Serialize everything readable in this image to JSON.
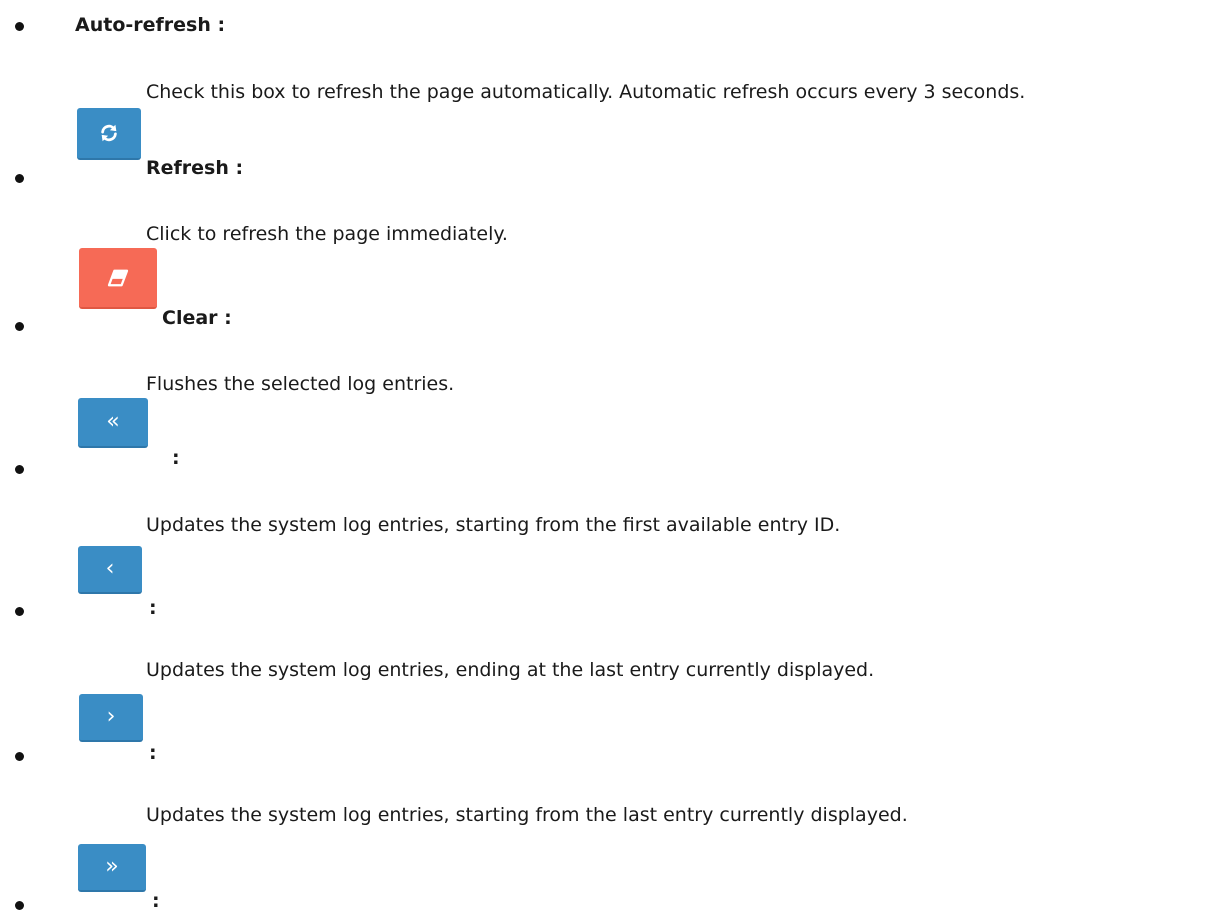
{
  "items": [
    {
      "label": "Auto-refresh :",
      "icon": null,
      "description": "Check this box to refresh the page automatically. Automatic refresh occurs every 3 seconds."
    },
    {
      "label": "Refresh :",
      "icon": "refresh-icon",
      "description": "Click to refresh the page immediately."
    },
    {
      "label": "Clear :",
      "icon": "eraser-icon",
      "description": "Flushes the selected log entries."
    },
    {
      "label": ":",
      "icon": "double-chevron-left-icon",
      "description": "Updates the system log entries, starting from the first available entry ID."
    },
    {
      "label": ":",
      "icon": "chevron-left-icon",
      "description": "Updates the system log entries, ending at the last entry currently displayed."
    },
    {
      "label": ":",
      "icon": "chevron-right-icon",
      "description": "Updates the system log entries, starting from the last entry currently displayed."
    },
    {
      "label": ":",
      "icon": "double-chevron-right-icon",
      "description": ""
    }
  ],
  "colors": {
    "button_blue": "#3a8dc5",
    "button_red": "#f66a56"
  }
}
